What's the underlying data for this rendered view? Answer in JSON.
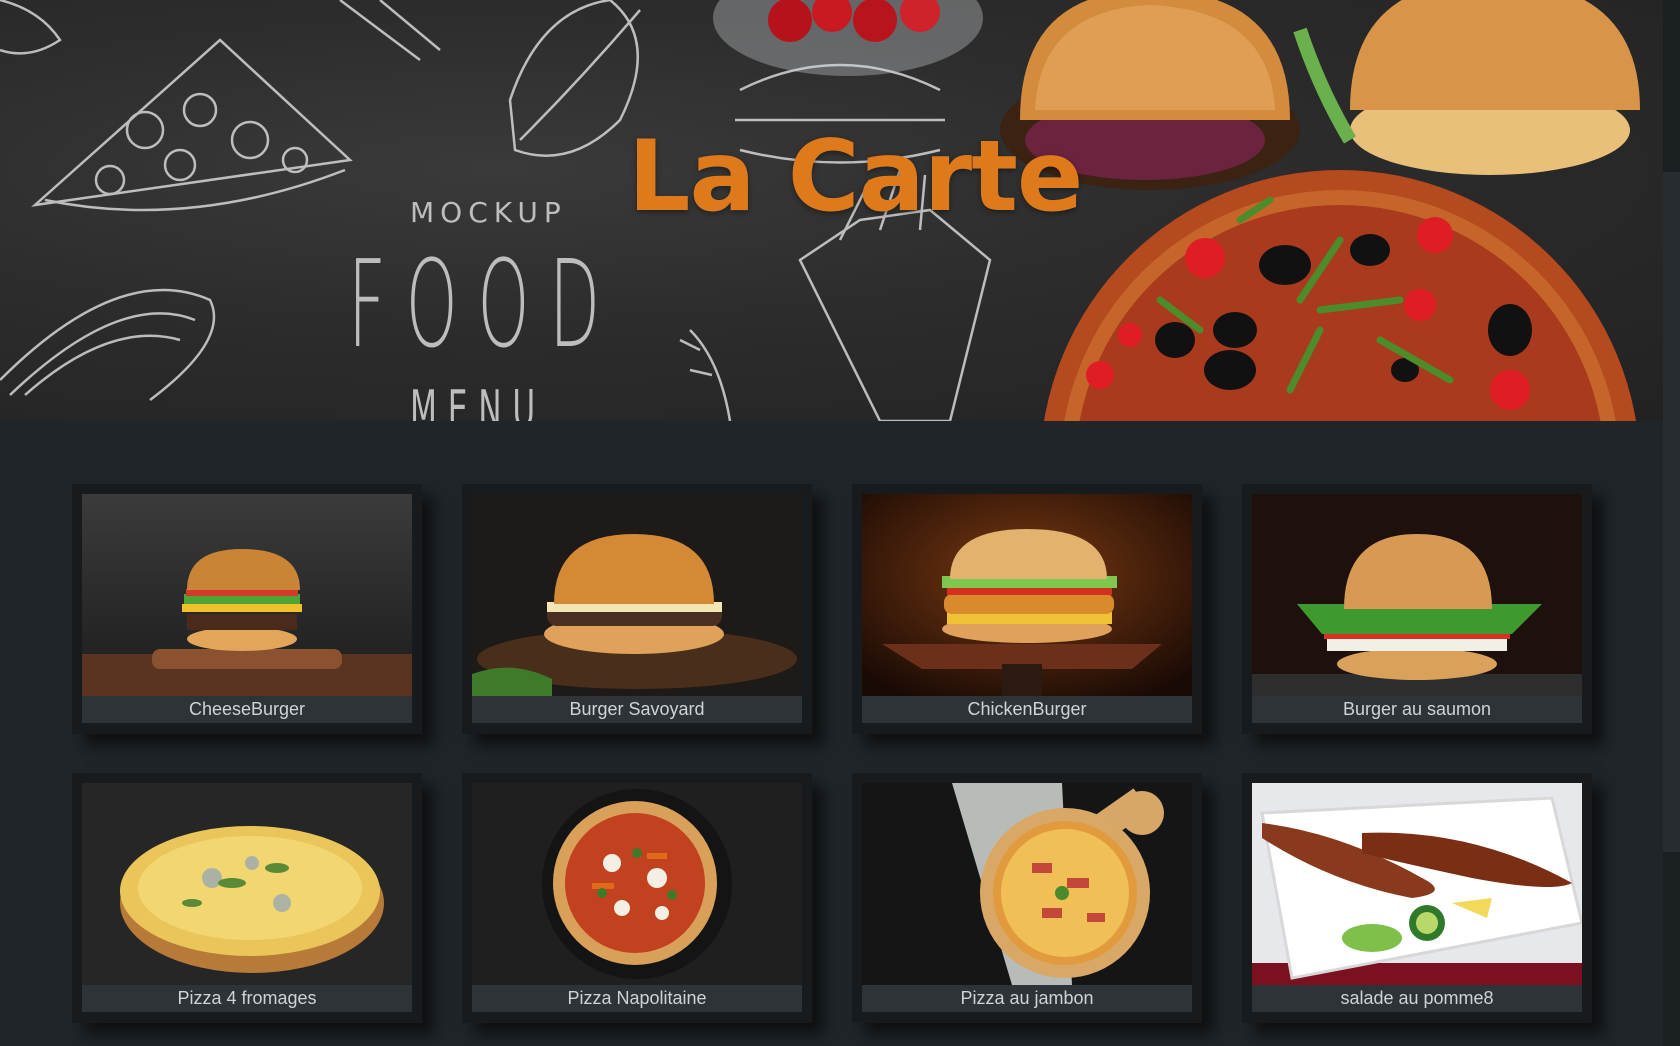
{
  "hero": {
    "title": "La Carte",
    "logo": {
      "top": "MOCKUP",
      "main": "FOOD",
      "bottom": "MENU"
    }
  },
  "menu": {
    "items": [
      {
        "label": "CheeseBurger",
        "kind": "burger"
      },
      {
        "label": "Burger Savoyard",
        "kind": "burger"
      },
      {
        "label": "ChickenBurger",
        "kind": "burger"
      },
      {
        "label": "Burger au saumon",
        "kind": "burger"
      },
      {
        "label": "Pizza 4 fromages",
        "kind": "pizza"
      },
      {
        "label": "Pizza Napolitaine",
        "kind": "pizza"
      },
      {
        "label": "Pizza au jambon",
        "kind": "pizza"
      },
      {
        "label": "salade au pomme8",
        "kind": "salad"
      }
    ]
  },
  "colors": {
    "accent": "#df7a1c",
    "background": "#1f2529",
    "card": "#171b1e",
    "label_bg": "#2d3337"
  }
}
